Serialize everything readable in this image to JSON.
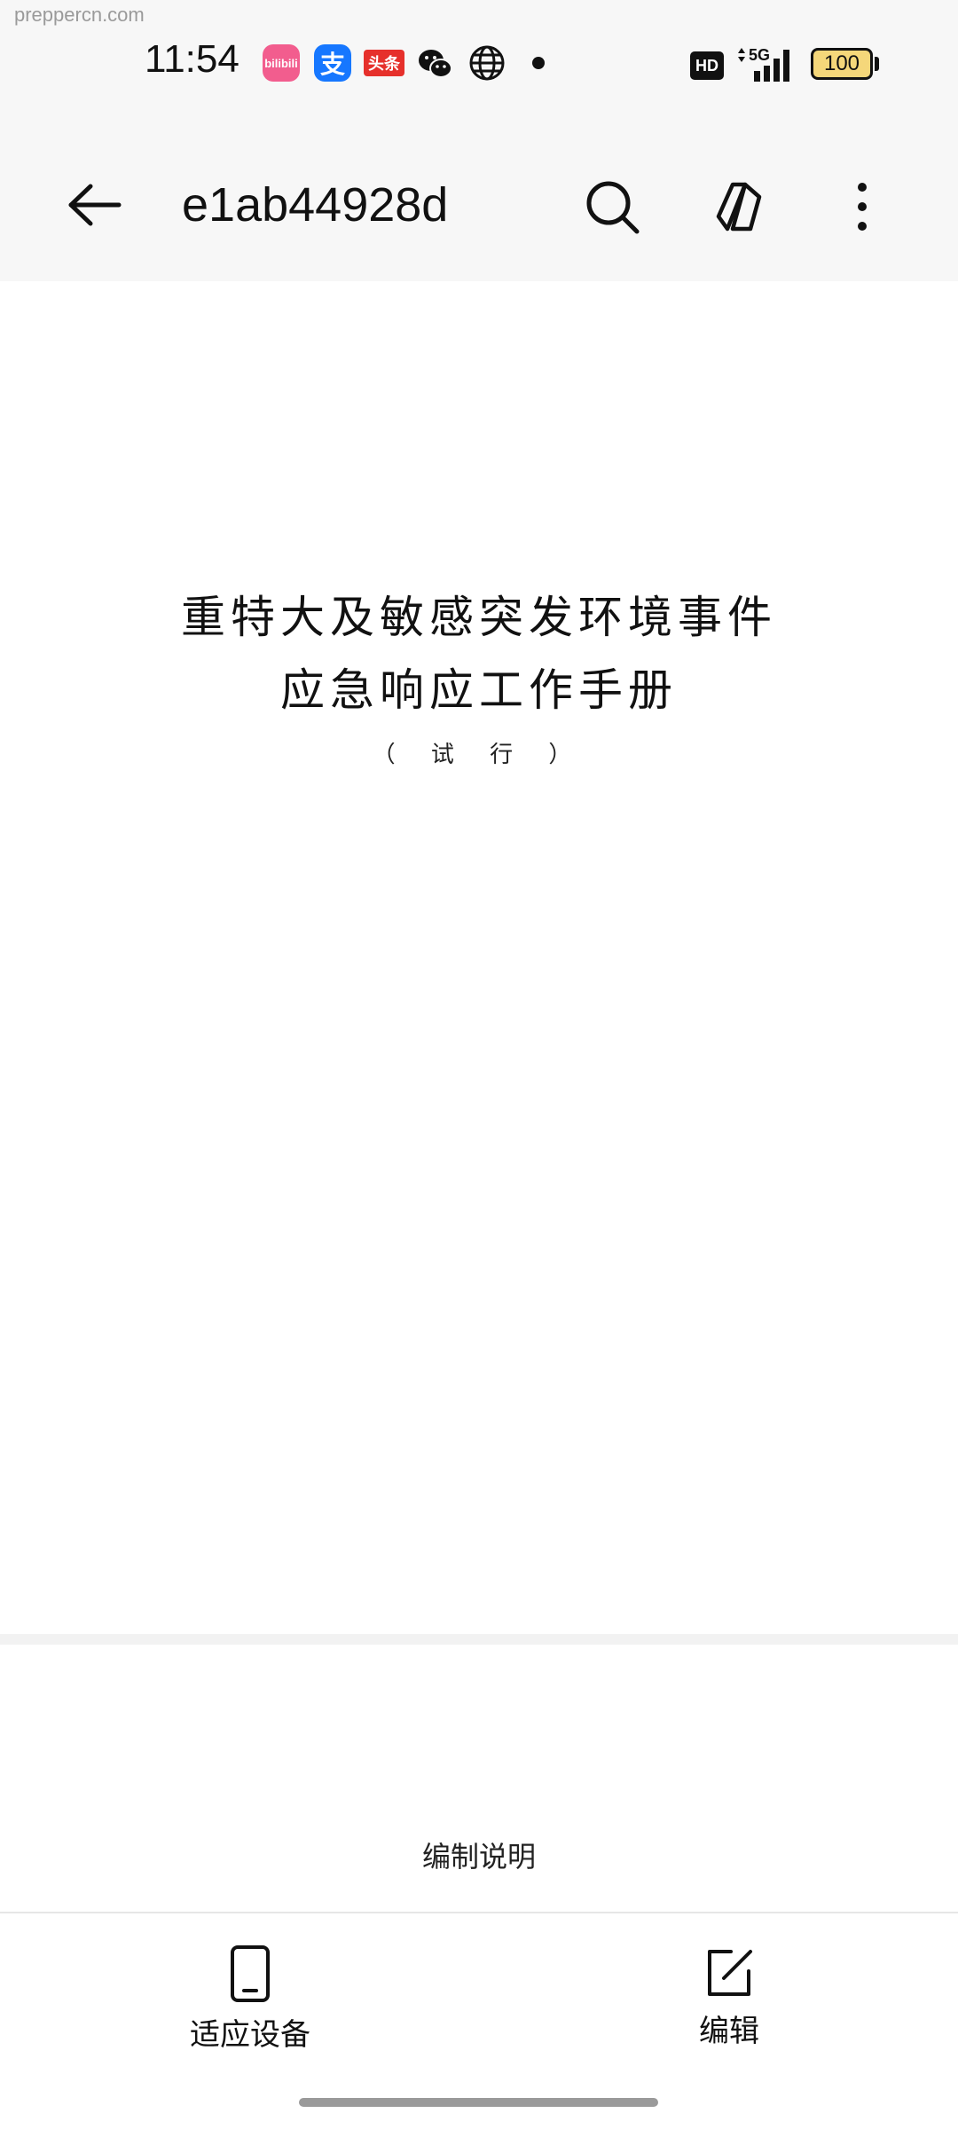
{
  "watermark": "preppercn.com",
  "status_bar": {
    "time": "11:54",
    "app_icons": [
      "bilibili-icon",
      "alipay-icon",
      "toutiao-icon",
      "wechat-icon",
      "globe-icon",
      "notification-dot-icon"
    ],
    "bilibili_label": "bilibili",
    "alipay_label": "支",
    "toutiao_label": "头条",
    "hd_label": "HD",
    "network_label": "5G",
    "battery": "100"
  },
  "toolbar": {
    "title": "e1ab44928d",
    "icons": [
      "back-arrow-icon",
      "search-icon",
      "shape-icon",
      "more-vertical-icon"
    ]
  },
  "document": {
    "title_line1": "重特大及敏感突发环境事件",
    "title_line2": "应急响应工作手册",
    "subtitle": "（ 试 行 ）",
    "next_section_heading": "编制说明"
  },
  "bottom_bar": {
    "fit_device_label": "适应设备",
    "edit_label": "编辑"
  },
  "colors": {
    "header_bg": "#f7f7f7",
    "battery_fill": "#f5d77a",
    "text": "#111111"
  }
}
